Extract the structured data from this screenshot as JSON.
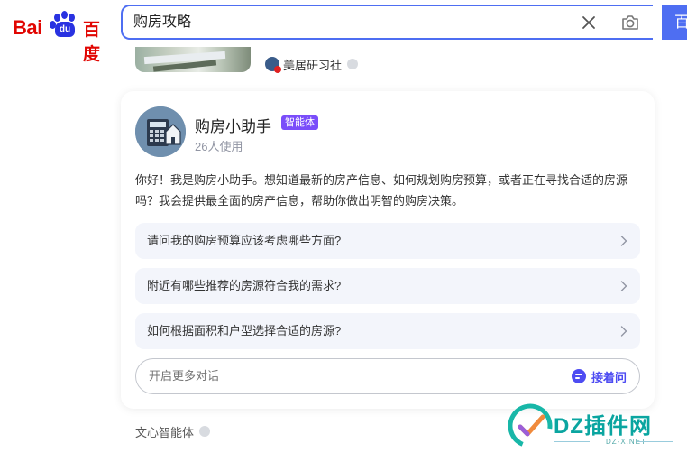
{
  "header": {
    "logo": {
      "bai": "Bai",
      "du": "du",
      "zh": "百度"
    },
    "search": {
      "value": "购房攻略",
      "button_label": "百"
    }
  },
  "previous_result": {
    "source": "美居研习社"
  },
  "assistant_card": {
    "name": "购房小助手",
    "badge": "智能体",
    "users": "26人使用",
    "intro": "你好！我是购房小助手。想知道最新的房产信息、如何规划购房预算，或者正在寻找合适的房源吗？我会提供最全面的房产信息，帮助你做出明智的购房决策。",
    "questions": [
      {
        "label": "请问我的购房预算应该考虑哪些方面?"
      },
      {
        "label": "附近有哪些推荐的房源符合我的需求?"
      },
      {
        "label": "如何根据面积和户型选择合适的房源?"
      }
    ],
    "chat_placeholder": "开启更多对话",
    "ask_label": "接着问"
  },
  "card_source": "文心智能体",
  "watermark": {
    "brand": "DZ插件网",
    "url": "DZ-X.NET"
  },
  "colors": {
    "accent": "#4e6ef2",
    "badge": "#7a4dfa",
    "ask": "#4e4cf2",
    "brand_red": "#e10602",
    "brand_blue": "#2932e1",
    "watermark": "#0aa5a0"
  },
  "icons": [
    "paw-logo-icon",
    "clear-icon",
    "camera-icon",
    "chevron-right-icon",
    "chat-bubble-icon",
    "more-dot-icon"
  ]
}
